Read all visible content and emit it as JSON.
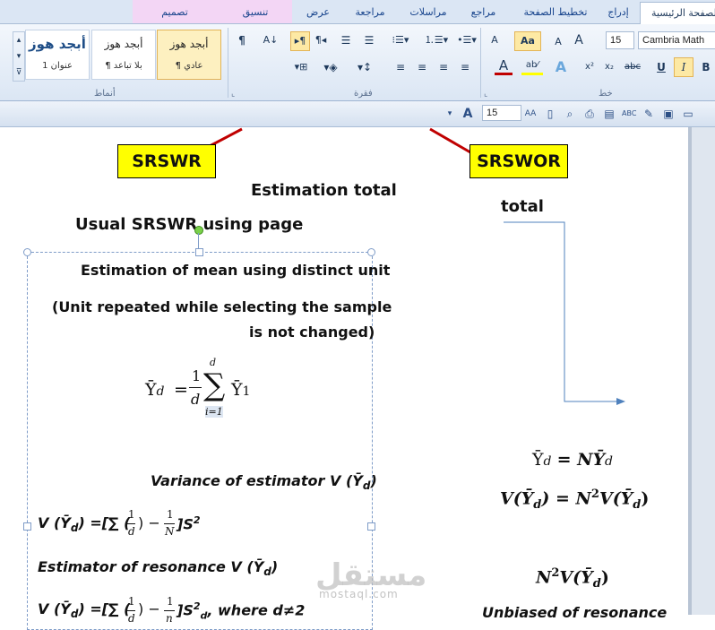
{
  "tabs": {
    "home": "الصفحة الرئيسية",
    "insert": "إدراج",
    "page_layout": "تخطيط الصفحة",
    "references": "مراجع",
    "mailings": "مراسلات",
    "review": "مراجعة",
    "view": "عرض",
    "format": "تنسيق",
    "design": "تصميم"
  },
  "ribbon": {
    "groups": {
      "font": "خط",
      "paragraph": "فقرة",
      "styles": "أنماط"
    },
    "font_name": "Cambria Math",
    "font_size": "15",
    "styles": [
      {
        "sample": "أبجد هوز",
        "name": "¶ عادي",
        "selected": true
      },
      {
        "sample": "أبجد هوز",
        "name": "¶ بلا تباعد",
        "selected": false
      },
      {
        "sample": "أبجد هوز",
        "name": "عنوان 1",
        "selected": false
      }
    ],
    "buttons": {
      "change_case": "Aa",
      "grow": "A",
      "shrink": "A",
      "bold": "B",
      "italic": "I",
      "underline": "U",
      "strike": "abc",
      "subscript": "x₂",
      "superscript": "x²",
      "clear": "A",
      "pilcrow": "¶"
    }
  },
  "quick_toolbar": {
    "font_size": "15"
  },
  "document": {
    "label_srswr": "SRSWR",
    "label_srswor": "SRSWOR",
    "estimation_total": "Estimation total",
    "usual_srswr": "Usual SRSWR using page",
    "total": "total",
    "frame": {
      "title": "Estimation of mean using distinct unit",
      "note_line1": "(Unit repeated while selecting the sample",
      "note_line2": "is not changed)",
      "formula_mean_lhs": "Ῡ",
      "formula_mean_sub": "d",
      "formula_mean_eq": "=",
      "formula_frac_num": "1",
      "formula_frac_den": "d",
      "formula_sum": "∑",
      "formula_sum_top": "d",
      "formula_sum_bottom": "i=1",
      "formula_term": "Ῡ",
      "formula_term_sub": "1",
      "variance_label": "Variance of estimator V (Ῡ",
      "variance_label_sub": "d",
      "variance_label_close": ")",
      "variance_formula": "V (Ῡ",
      "variance_formula_sub": "d",
      "variance_formula_rest": ") =[∑ (",
      "variance_f1_num": "1",
      "variance_f1_den": "d",
      "variance_minus": ") −",
      "variance_f2_num": "1",
      "variance_f2_den": "N",
      "variance_tail": "]S",
      "variance_tail_sup": "2",
      "estimator_label": "Estimator of resonance V (Ῡ",
      "estimator_label_sub": "d",
      "estimator_label_close": ")",
      "last_line": "V (Ῡ",
      "last_line_sub": "d",
      "last_line_rest": ") =[∑ (",
      "last_f1_num": "1",
      "last_f1_den": "d",
      "last_minus": ") −",
      "last_f2_num": "1",
      "last_f2_den": "n",
      "last_tail": "]S",
      "last_tail_sup": "2",
      "last_tail_sub": "d",
      "last_cond": ", where d≠2"
    },
    "right": {
      "eq1_lhs": "Ῡ",
      "eq1_lhs_sub": "d",
      "eq1_rest": "= NῩ",
      "eq1_rest_sub": "d",
      "eq2_a": "V(Ῡ",
      "eq2_a_sub": "d",
      "eq2_b": ") = N",
      "eq2_b_sup": "2",
      "eq2_c": "V(Ῡ",
      "eq2_c_sub": "d",
      "eq2_d": ")",
      "eq3_a": "N",
      "eq3_a_sup": "2",
      "eq3_b": "V(Ῡ",
      "eq3_b_sub": "d",
      "eq3_c": ")",
      "unbiased": "Unbiased of resonance"
    }
  },
  "watermark": {
    "text": "مستقل",
    "sub": "mostaql.com"
  },
  "colors": {
    "highlight": "#ffff00",
    "connector": "#c00000",
    "arrow": "#4f81bd"
  }
}
